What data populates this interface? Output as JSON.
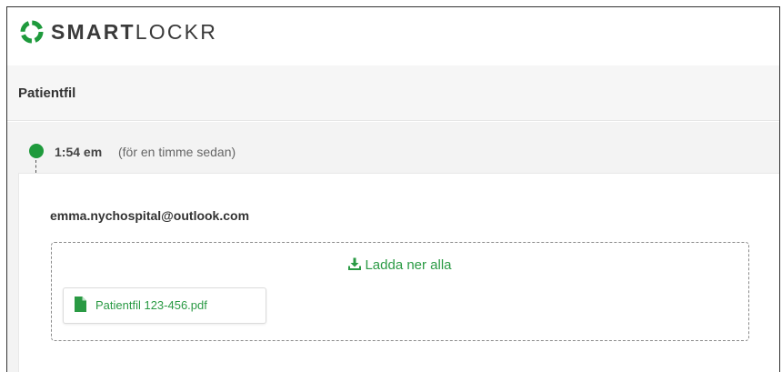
{
  "brand": {
    "name_bold": "SMART",
    "name_light": "LOCKR",
    "color": "#1e9a3c"
  },
  "page": {
    "title": "Patientfil"
  },
  "message": {
    "time": "1:54 em",
    "time_ago": "(för en timme sedan)",
    "sender": "emma.nychospital@outlook.com",
    "download_all_label": "Ladda ner alla",
    "download_icon": "download-icon",
    "files": [
      {
        "name": "Patientfil 123-456.pdf",
        "icon": "pdf-file-icon"
      }
    ]
  }
}
